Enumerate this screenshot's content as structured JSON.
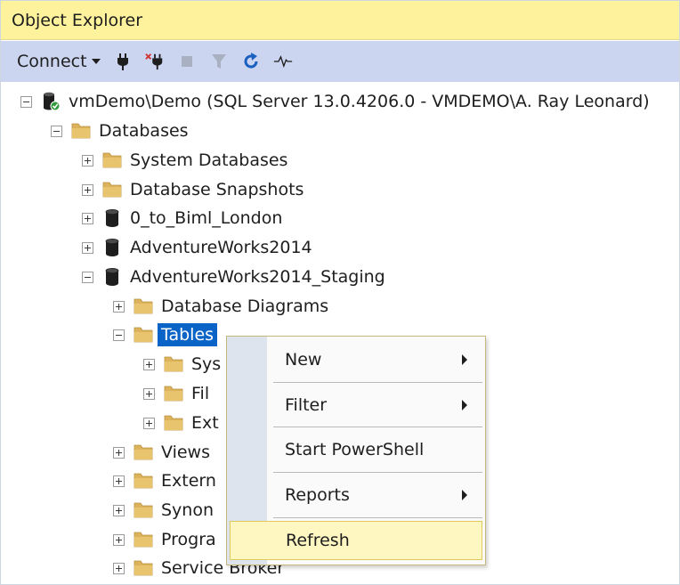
{
  "window": {
    "title": "Object Explorer"
  },
  "toolbar": {
    "connect_label": "Connect",
    "icons": [
      "connect-plug-icon",
      "disconnect-icon",
      "stop-icon",
      "filter-icon",
      "refresh-icon",
      "activity-monitor-icon"
    ]
  },
  "tree": {
    "server": "vmDemo\\Demo (SQL Server 13.0.4206.0 - VMDEMO\\A. Ray Leonard)",
    "databases": "Databases",
    "system_databases": "System Databases",
    "database_snapshots": "Database Snapshots",
    "db_0_to_biml": "0_to_Biml_London",
    "db_adventureworks": "AdventureWorks2014",
    "db_adventureworks_staging": "AdventureWorks2014_Staging",
    "database_diagrams": "Database Diagrams",
    "tables": "Tables",
    "system_tables": "Sys",
    "file_tables": "Fil",
    "external_tables": "Ext",
    "views": "Views",
    "external_resources": "Extern",
    "synonyms": "Synon",
    "programmability": "Progra",
    "service_broker": "Service Broker"
  },
  "context_menu": {
    "new": "New",
    "filter": "Filter",
    "start_powershell": "Start PowerShell",
    "reports": "Reports",
    "refresh": "Refresh"
  },
  "colors": {
    "title_bar": "#fff29d",
    "toolbar": "#ccd5f0",
    "selection": "#0a64c8",
    "menu_hover": "#fff7c2",
    "folder": "#dcb35c"
  }
}
